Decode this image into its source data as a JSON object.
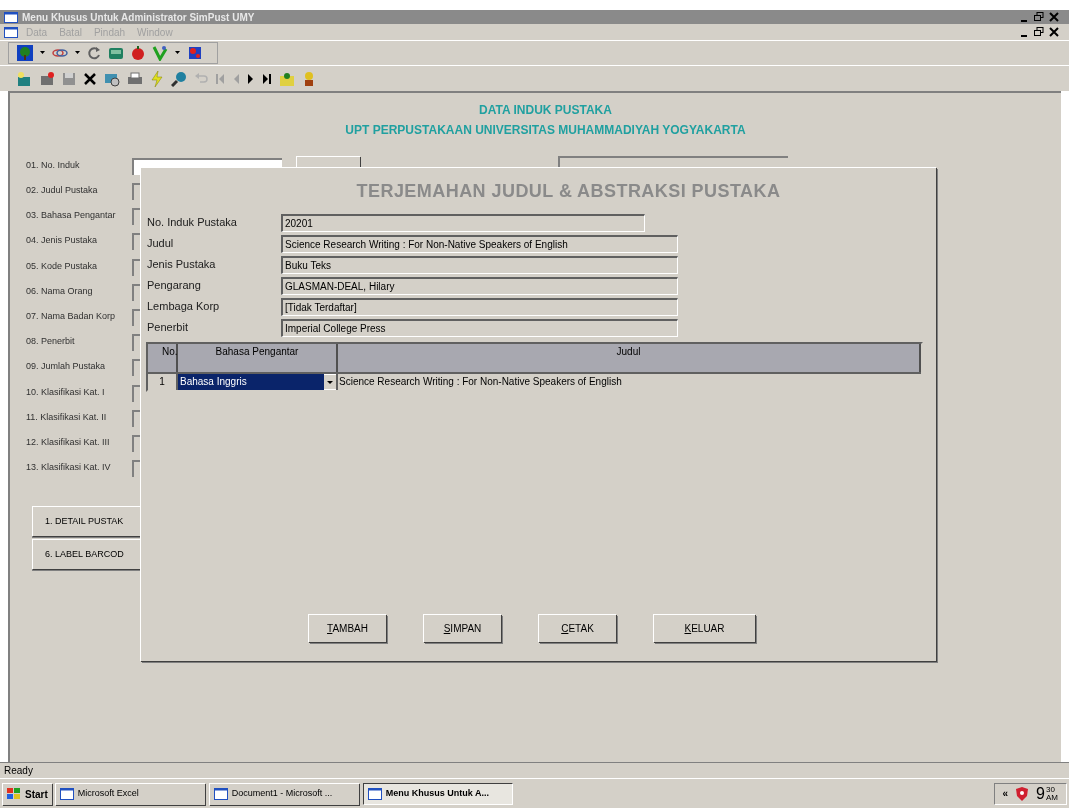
{
  "window": {
    "title": "Menu Khusus Untuk Administrator SimPust UMY"
  },
  "menu": [
    "Data",
    "Batal",
    "Pindah",
    "Window"
  ],
  "header": {
    "line_1": "DATA INDUK PUSTAKA",
    "line_2": "UPT PERPUSTAKAAN UNIVERSITAS MUHAMMADIYAH YOGYAKARTA"
  },
  "form_labels": [
    "01. No. Induk",
    "02. Judul Pustaka",
    "03. Bahasa Pengantar",
    "04. Jenis Pustaka",
    "05. Kode Pustaka",
    "06. Nama Orang",
    "07. Nama Badan Korp",
    "08. Penerbit",
    "09. Jumlah Pustaka",
    "10. Klasifikasi Kat. I",
    "11. Klasifikasi Kat. II",
    "12. Klasifikasi Kat. III",
    "13. Klasifikasi Kat. IV"
  ],
  "form_buttons": [
    "1. DETAIL PUSTAK",
    "6. LABEL BARCOD"
  ],
  "dialog": {
    "title": "TERJEMAHAN JUDUL & ABSTRAKSI PUSTAKA",
    "fields": [
      {
        "label": "No. Induk Pustaka",
        "value": "20201"
      },
      {
        "label": "Judul",
        "value": "Science Research Writing : For Non-Native Speakers of English"
      },
      {
        "label": "Jenis Pustaka",
        "value": "Buku Teks"
      },
      {
        "label": "Pengarang",
        "value": "GLASMAN-DEAL, Hilary"
      },
      {
        "label": "Lembaga Korp",
        "value": "[Tidak Terdaftar]"
      },
      {
        "label": "Penerbit",
        "value": "Imperial College Press"
      }
    ],
    "table": {
      "columns": [
        "No.",
        "Bahasa Pengantar",
        "Judul"
      ],
      "rows": [
        {
          "no": "1",
          "bahasa": "Bahasa Inggris",
          "judul": "Science Research Writing : For Non-Native Speakers of English",
          "selected": true
        }
      ]
    },
    "buttons": [
      "TAMBAH",
      "SIMPAN",
      "CETAK",
      "KELUAR"
    ]
  },
  "status_bar": "Ready",
  "taskbar": {
    "start": "Start",
    "tasks": [
      {
        "label": "Microsoft Excel",
        "selected": false
      },
      {
        "label": "Document1 - Microsoft ...",
        "selected": false
      },
      {
        "label": "Menu Khusus Untuk A...",
        "selected": true
      }
    ],
    "tray_arrow": "«",
    "clock": {
      "hour": "9",
      "minute": "30",
      "ampm": "AM"
    }
  }
}
